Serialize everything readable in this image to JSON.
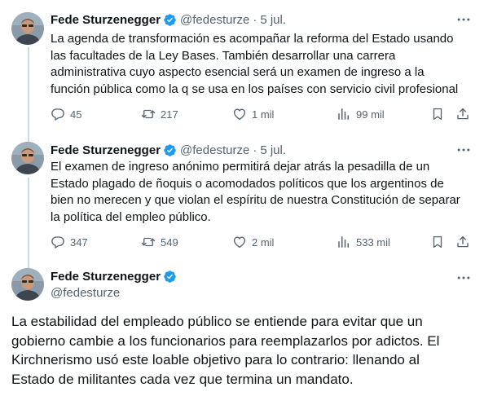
{
  "colors": {
    "text": "#0f1419",
    "muted": "#536471",
    "verified": "#1d9bf0",
    "thread_line": "#cfd9de"
  },
  "tweets": [
    {
      "name": "Fede Sturzenegger",
      "handle": "@fedesturze",
      "separator": "·",
      "date": "5 jul.",
      "lines": [
        "La agenda de transformación es acompañar la reforma del Estado usando",
        "las facultades de la Ley Bases. También desarrollar una carrera",
        "administrativa cuyo aspecto esencial será un examen de ingreso a la",
        "función pública como la q se usa en los países con  servicio civil profesional"
      ],
      "replies": "45",
      "retweets": "217",
      "likes": "1 mil",
      "views": "99 mil"
    },
    {
      "name": "Fede Sturzenegger",
      "handle": "@fedesturze",
      "separator": "·",
      "date": "5 jul.",
      "lines": [
        "El examen de ingreso anónimo permitirá dejar atrás la pesadilla de un",
        "Estado plagado de ñoquis o acomodados políticos que los argentinos de",
        "bien no merecen y que violan el espíritu de nuestra Constitución de separar",
        "la política del empleo público."
      ],
      "replies": "347",
      "retweets": "549",
      "likes": "2 mil",
      "views": "533 mil"
    }
  ],
  "main_tweet": {
    "name": "Fede Sturzenegger",
    "handle": "@fedesturze",
    "lines": [
      "La estabilidad del empleado público se entiende para evitar que un",
      "gobierno cambie a los funcionarios para reemplazarlos por adictos. El",
      "Kirchnerismo usó este loable objetivo para lo contrario: llenando al",
      "Estado de militantes cada vez que termina un mandato."
    ]
  },
  "icons": [
    "more-icon",
    "verified-badge-icon",
    "reply-icon",
    "retweet-icon",
    "like-icon",
    "views-icon",
    "bookmark-icon",
    "share-icon"
  ]
}
